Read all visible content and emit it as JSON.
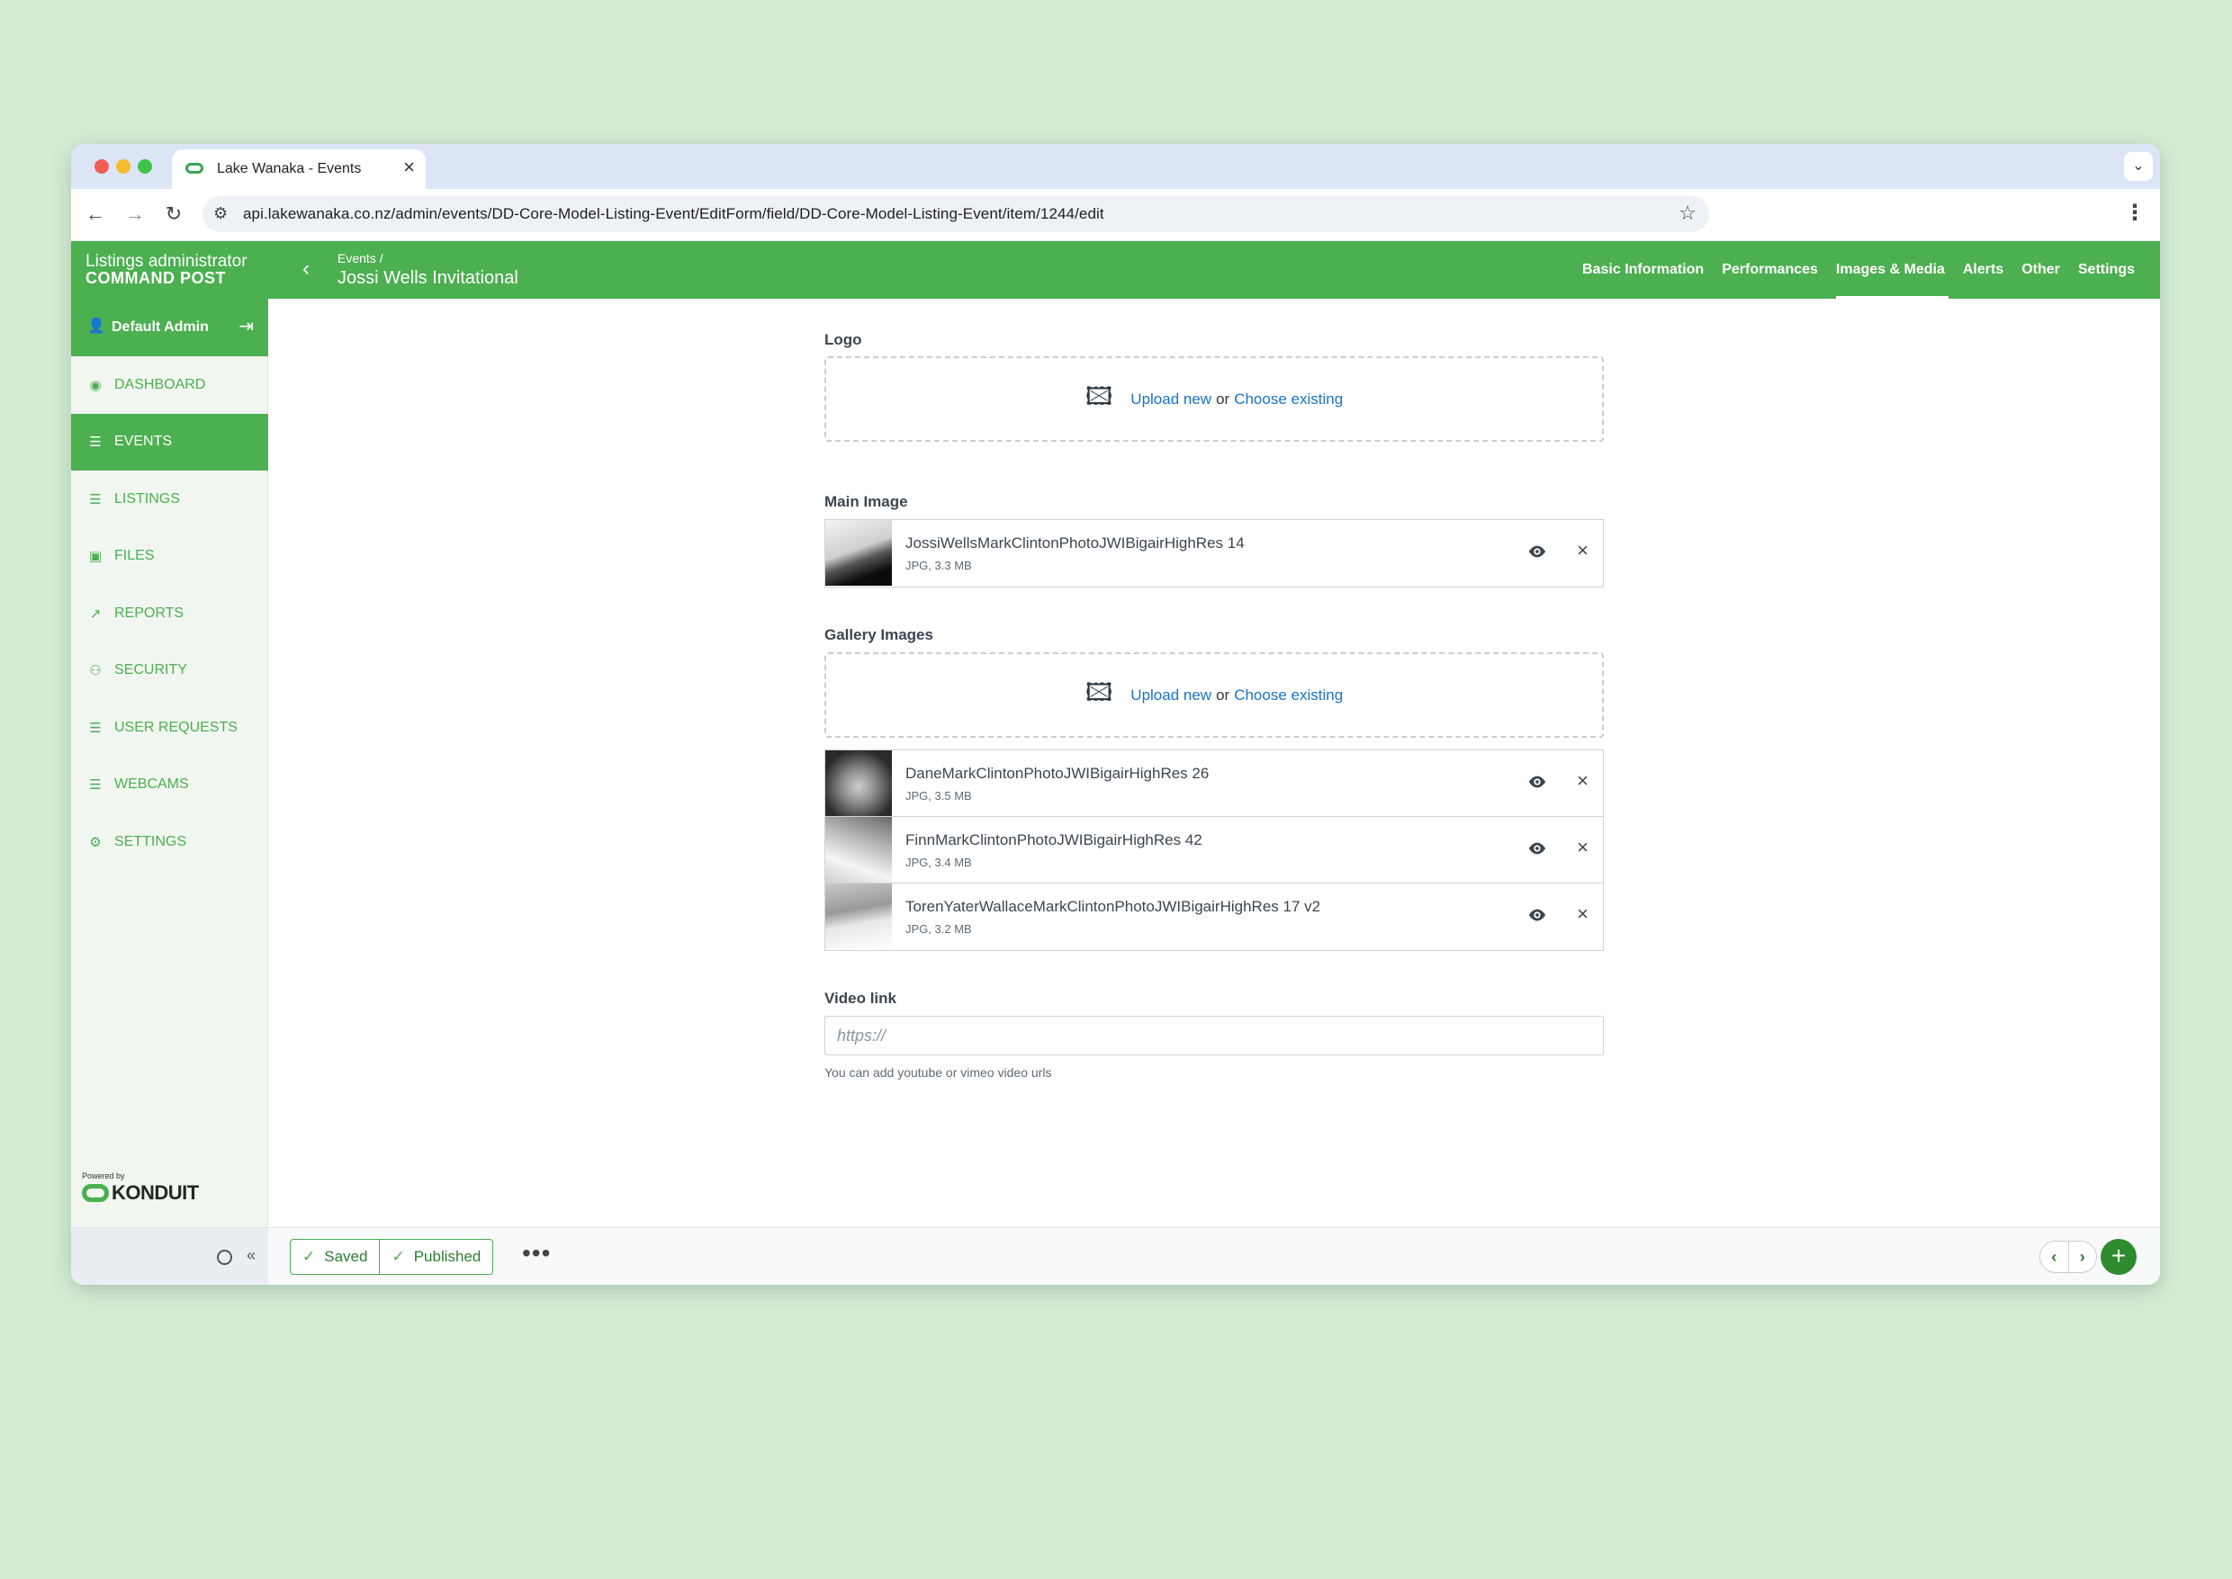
{
  "browser": {
    "tab_title": "Lake Wanaka - Events",
    "url": "api.lakewanaka.co.nz/admin/events/DD-Core-Model-Listing-Event/EditForm/field/DD-Core-Model-Listing-Event/item/1244/edit"
  },
  "header": {
    "brand_line1": "Listings administrator",
    "brand_line2": "COMMAND POST",
    "breadcrumb_parent": "Events /",
    "page_title": "Jossi Wells Invitational",
    "nav": [
      {
        "label": "Basic Information",
        "active": false
      },
      {
        "label": "Performances",
        "active": false
      },
      {
        "label": "Images & Media",
        "active": true
      },
      {
        "label": "Alerts",
        "active": false
      },
      {
        "label": "Other",
        "active": false
      },
      {
        "label": "Settings",
        "active": false
      }
    ]
  },
  "sidebar": {
    "user_name": "Default Admin",
    "items": [
      {
        "label": "DASHBOARD",
        "icon": "dashboard-icon",
        "active": false
      },
      {
        "label": "EVENTS",
        "icon": "database-icon",
        "active": true
      },
      {
        "label": "LISTINGS",
        "icon": "database-icon",
        "active": false
      },
      {
        "label": "FILES",
        "icon": "image-icon",
        "active": false
      },
      {
        "label": "REPORTS",
        "icon": "chart-icon",
        "active": false
      },
      {
        "label": "SECURITY",
        "icon": "users-icon",
        "active": false
      },
      {
        "label": "USER REQUESTS",
        "icon": "database-icon",
        "active": false
      },
      {
        "label": "WEBCAMS",
        "icon": "database-icon",
        "active": false
      },
      {
        "label": "SETTINGS",
        "icon": "gear-icon",
        "active": false
      }
    ],
    "powered_by": "Powered by",
    "powered_brand": "KONDUIT"
  },
  "form": {
    "logo_label": "Logo",
    "main_image_label": "Main Image",
    "gallery_label": "Gallery Images",
    "upload_new": "Upload new",
    "or": "or",
    "choose_existing": "Choose existing",
    "main_image": {
      "name": "JossiWellsMarkClintonPhotoJWIBigairHighRes 14",
      "meta": "JPG, 3.3 MB"
    },
    "gallery": [
      {
        "name": "DaneMarkClintonPhotoJWIBigairHighRes 26",
        "meta": "JPG, 3.5 MB"
      },
      {
        "name": "FinnMarkClintonPhotoJWIBigairHighRes 42",
        "meta": "JPG, 3.4 MB"
      },
      {
        "name": "TorenYaterWallaceMarkClintonPhotoJWIBigairHighRes 17 v2",
        "meta": "JPG, 3.2 MB"
      }
    ],
    "video_label": "Video link",
    "video_placeholder": "https://",
    "video_help": "You can add youtube or vimeo video urls"
  },
  "footer": {
    "saved_label": "Saved",
    "published_label": "Published",
    "more_label": "•••"
  },
  "colors": {
    "brand_green": "#4caf50",
    "link_blue": "#1a73c8",
    "background": "#d3edd5"
  }
}
